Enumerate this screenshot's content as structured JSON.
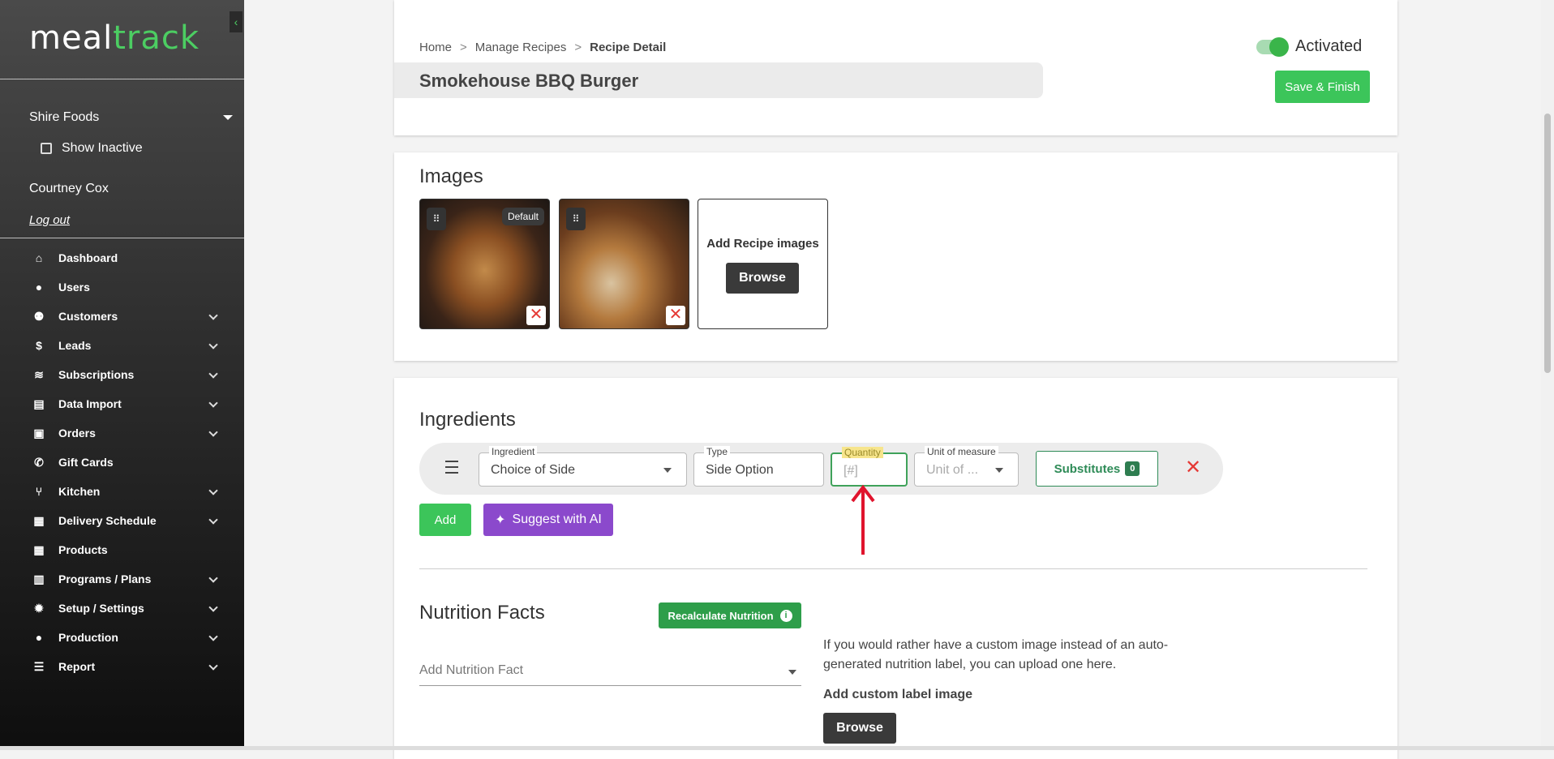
{
  "brand": {
    "part1": "meal",
    "part2": "track"
  },
  "sidebar": {
    "collapse_glyph": "‹",
    "organization": "Shire Foods",
    "show_inactive": "Show Inactive",
    "user_name": "Courtney Cox",
    "logout": "Log out",
    "items": [
      {
        "label": "Dashboard",
        "icon": "home-icon",
        "has_children": false
      },
      {
        "label": "Users",
        "icon": "user-icon",
        "has_children": false
      },
      {
        "label": "Customers",
        "icon": "users-icon",
        "has_children": true
      },
      {
        "label": "Leads",
        "icon": "dollar-icon",
        "has_children": true
      },
      {
        "label": "Subscriptions",
        "icon": "layers-icon",
        "has_children": true
      },
      {
        "label": "Data Import",
        "icon": "file-icon",
        "has_children": true
      },
      {
        "label": "Orders",
        "icon": "bag-icon",
        "has_children": true
      },
      {
        "label": "Gift Cards",
        "icon": "phone-icon",
        "has_children": false
      },
      {
        "label": "Kitchen",
        "icon": "utensils-icon",
        "has_children": true
      },
      {
        "label": "Delivery Schedule",
        "icon": "calendar-icon",
        "has_children": true
      },
      {
        "label": "Products",
        "icon": "calendar-icon",
        "has_children": false
      },
      {
        "label": "Programs / Plans",
        "icon": "clipboard-icon",
        "has_children": true
      },
      {
        "label": "Setup / Settings",
        "icon": "gear-icon",
        "has_children": true
      },
      {
        "label": "Production",
        "icon": "user-icon",
        "has_children": true
      },
      {
        "label": "Report",
        "icon": "list-icon",
        "has_children": true
      }
    ]
  },
  "header": {
    "breadcrumb": [
      "Home",
      "Manage Recipes",
      "Recipe Detail"
    ],
    "breadcrumb_sep": ">",
    "recipe_name": "Smokehouse BBQ Burger",
    "status_label": "Activated",
    "save_label": "Save & Finish"
  },
  "images": {
    "title": "Images",
    "default_badge": "Default",
    "add_label": "Add Recipe images",
    "browse_label": "Browse",
    "remove_glyph": "✕",
    "drag_glyph": "⠿"
  },
  "ingredients": {
    "title": "Ingredients",
    "row": {
      "ingredient_label": "Ingredient",
      "ingredient_value": "Choice of Side",
      "type_label": "Type",
      "type_value": "Side Option",
      "quantity_label": "Quantity",
      "quantity_placeholder": "[#]",
      "unit_label": "Unit of measure",
      "unit_placeholder": "Unit of ...",
      "substitutes_label": "Substitutes",
      "substitutes_count": "0",
      "remove_glyph": "✕"
    },
    "add_label": "Add",
    "suggest_label": "Suggest with AI",
    "suggest_glyph": "✦"
  },
  "nutrition": {
    "title": "Nutrition Facts",
    "recalc_label": "Recalculate Nutrition",
    "info_glyph": "i",
    "add_placeholder": "Add Nutrition Fact",
    "custom_text": "If you would rather have a custom image instead of an auto-generated nutrition label, you can upload one here.",
    "custom_label": "Add custom label image",
    "browse_label": "Browse"
  },
  "colors": {
    "accent": "#3cc55a",
    "purple": "#8b49cc",
    "danger": "#e53935",
    "arrow": "#e0142d"
  }
}
